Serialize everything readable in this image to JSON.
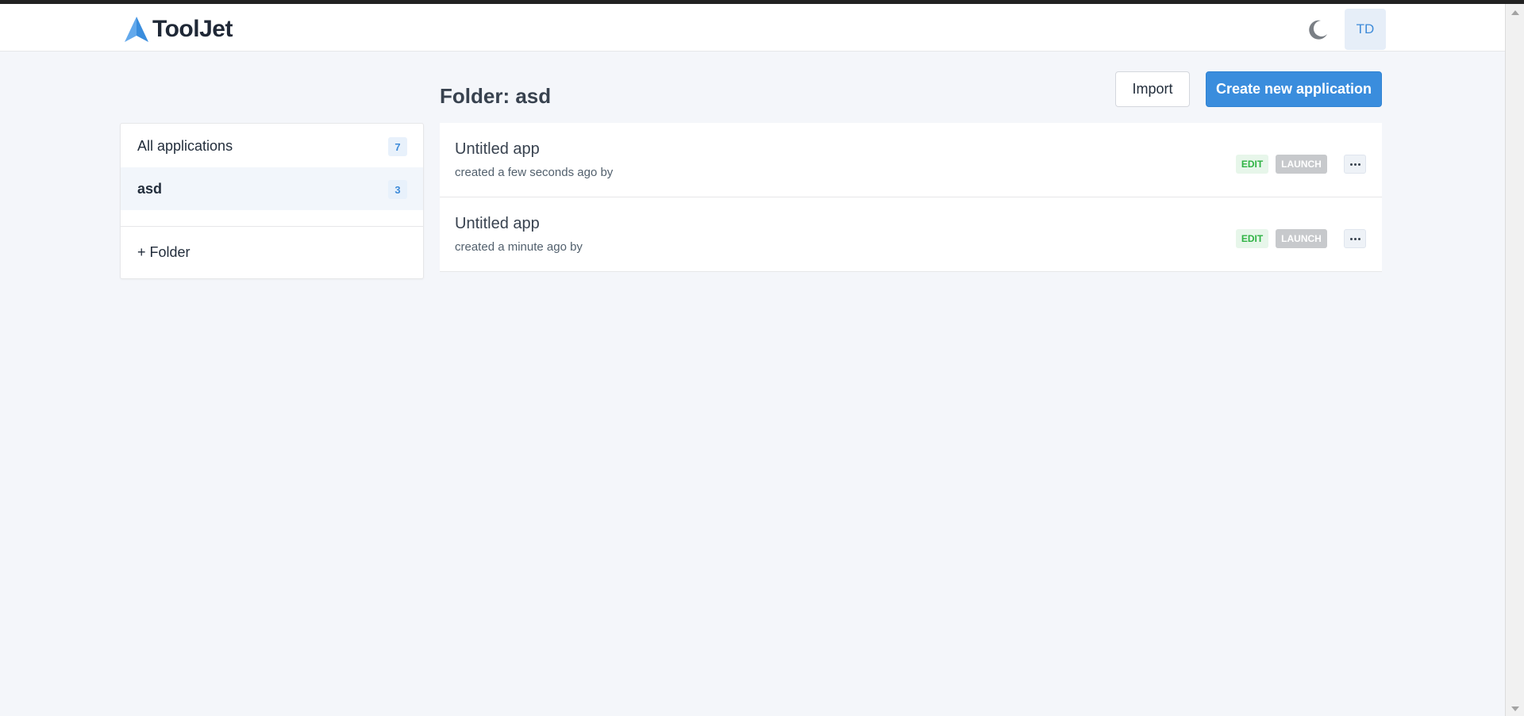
{
  "brand": {
    "name": "ToolJet",
    "accent": "#3a8ddd"
  },
  "header": {
    "theme_toggle_icon": "moon-icon",
    "avatar_initials": "TD"
  },
  "page": {
    "folder_title": "Folder: asd",
    "import_label": "Import",
    "create_label": "Create new application"
  },
  "sidebar": {
    "items": [
      {
        "label": "All applications",
        "count": "7",
        "active": false
      },
      {
        "label": "asd",
        "count": "3",
        "active": true
      }
    ],
    "add_folder_label": "+ Folder"
  },
  "apps": [
    {
      "name": "Untitled app",
      "meta": "created a few seconds ago by",
      "edit": "EDIT",
      "launch": "LAUNCH"
    },
    {
      "name": "Untitled app",
      "meta": "created a minute ago by",
      "edit": "EDIT",
      "launch": "LAUNCH"
    }
  ],
  "colors": {
    "edit_green": "#2fb344",
    "launch_grey": "#c7c9cc",
    "background": "#f4f6fa"
  }
}
